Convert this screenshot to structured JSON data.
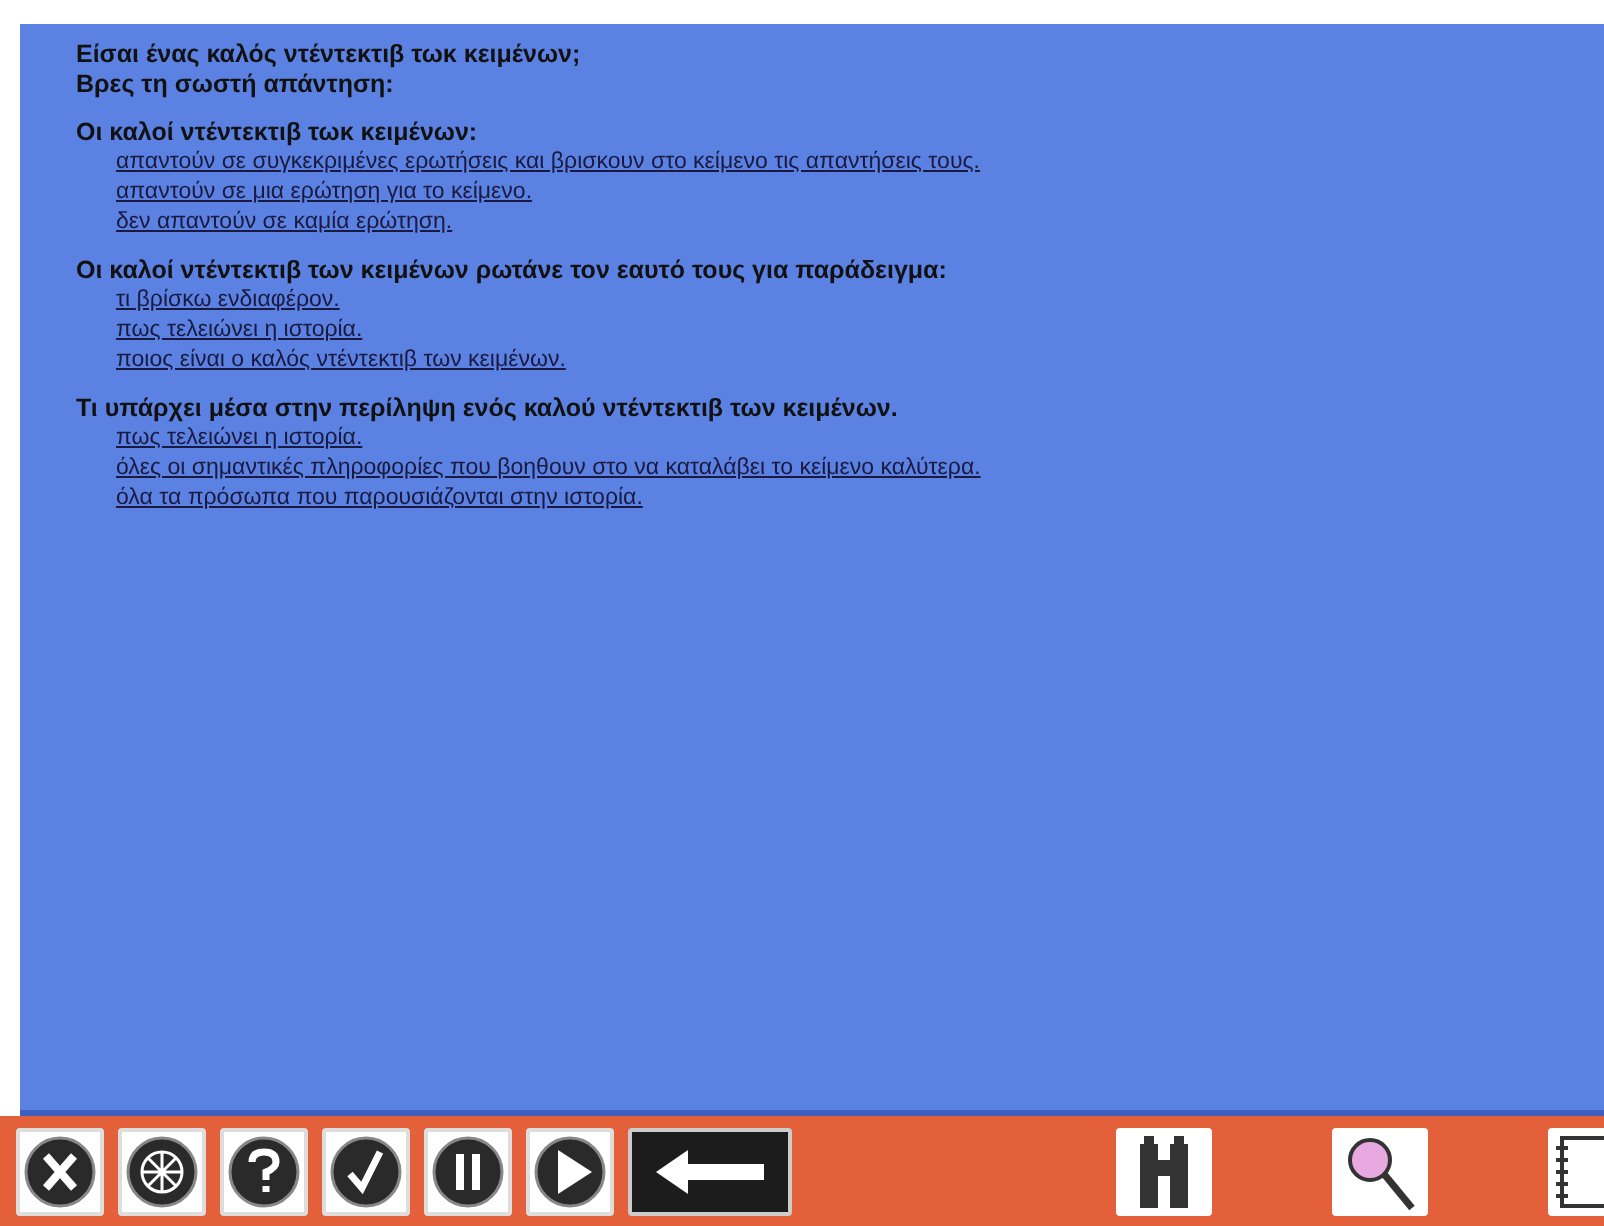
{
  "intro": [
    "Είσαι ένας καλός ντέντεκτιβ τωκ κειμένων;",
    "Βρες τη σωστή απάντηση:"
  ],
  "questions": [
    {
      "heading": "Οι καλοί ντέντεκτιβ τωκ κειμένων:",
      "answers": [
        "απαντούν σε συγκεκριμένες ερωτήσεις και βρισκουν στο κείμενο τις απαντήσεις τους.",
        "απαντούν σε μια ερώτηση για το κείμενο.",
        "δεν απαντούν σε καμία ερώτηση."
      ]
    },
    {
      "heading": "Οι καλοί ντέντεκτιβ των κειμένων ρωτάνε τον εαυτό τους για παράδειγμα:",
      "answers": [
        "τι βρίσκω ενδιαφέρον.",
        "πως τελειώνει η ιστορία.",
        "ποιος είναι ο καλός ντέντεκτιβ των κειμένων."
      ]
    },
    {
      "heading": "Τι υπάρχει μέσα στην περίληψη ενός καλού ντέντεκτιβ των κειμένων.",
      "answers": [
        "πως τελειώνει η ιστορία.",
        "όλες οι σημαντικές πληροφορίες που βοηθουν στο να καταλάβει το κείμενο καλύτερα.",
        "όλα τα πρόσωπα που παρουσιάζονται στην ιστορία."
      ]
    }
  ],
  "toolbar": [
    {
      "kind": "close"
    },
    {
      "kind": "wheel"
    },
    {
      "kind": "help"
    },
    {
      "kind": "check"
    },
    {
      "kind": "pause"
    },
    {
      "kind": "play"
    },
    {
      "kind": "back"
    },
    {
      "kind": "binoculars"
    },
    {
      "kind": "magnifier"
    },
    {
      "kind": "notebook"
    }
  ]
}
